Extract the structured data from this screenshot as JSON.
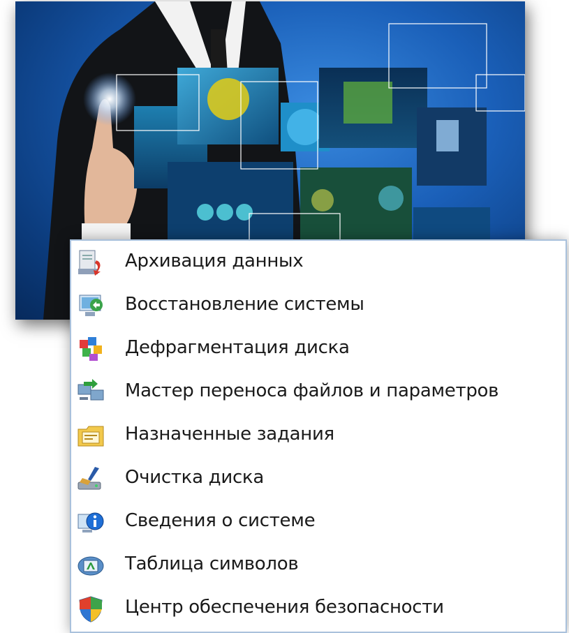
{
  "menu": {
    "items": [
      {
        "label": "Архивация данных",
        "icon": "backup-icon"
      },
      {
        "label": "Восстановление системы",
        "icon": "system-restore-icon"
      },
      {
        "label": "Дефрагментация диска",
        "icon": "defragment-icon"
      },
      {
        "label": "Мастер переноса файлов и параметров",
        "icon": "transfer-wizard-icon"
      },
      {
        "label": "Назначенные задания",
        "icon": "scheduled-tasks-icon"
      },
      {
        "label": "Очистка диска",
        "icon": "disk-cleanup-icon"
      },
      {
        "label": "Сведения о системе",
        "icon": "system-info-icon"
      },
      {
        "label": "Таблица символов",
        "icon": "character-map-icon"
      },
      {
        "label": "Центр обеспечения безопасности",
        "icon": "security-center-icon"
      }
    ]
  },
  "colors": {
    "photo_background": "#1a5fb8",
    "menu_border": "#a9c1dc",
    "menu_text": "#1a1a1a"
  }
}
